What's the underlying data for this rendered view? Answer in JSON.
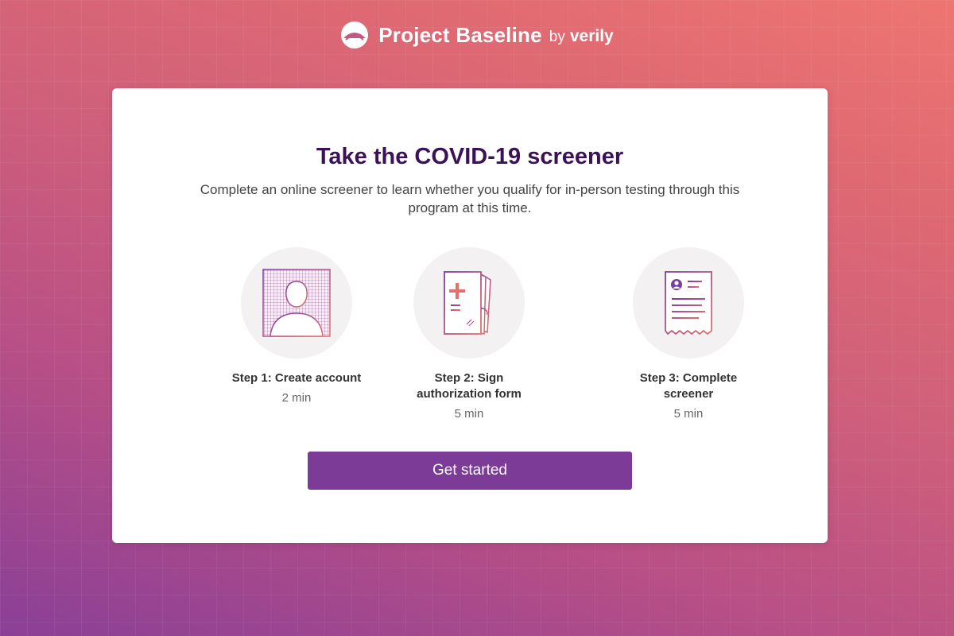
{
  "brand": {
    "name": "Project Baseline",
    "by": "by",
    "partner": "verily"
  },
  "card": {
    "title": "Take the COVID-19 screener",
    "subtitle": "Complete an online screener to learn whether you qualify for in-person testing through this program at this time."
  },
  "steps": [
    {
      "label": "Step 1: Create account",
      "time": "2 min",
      "icon": "person-portrait-icon"
    },
    {
      "label": "Step 2: Sign authorization form",
      "time": "5 min",
      "icon": "medical-form-icon"
    },
    {
      "label": "Step 3: Complete screener",
      "time": "5 min",
      "icon": "profile-document-icon"
    }
  ],
  "cta": {
    "label": "Get started"
  },
  "colors": {
    "title": "#3b1257",
    "button": "#7b3b96",
    "icon_gradient_start": "#7a3ea0",
    "icon_gradient_end": "#e8706a"
  }
}
